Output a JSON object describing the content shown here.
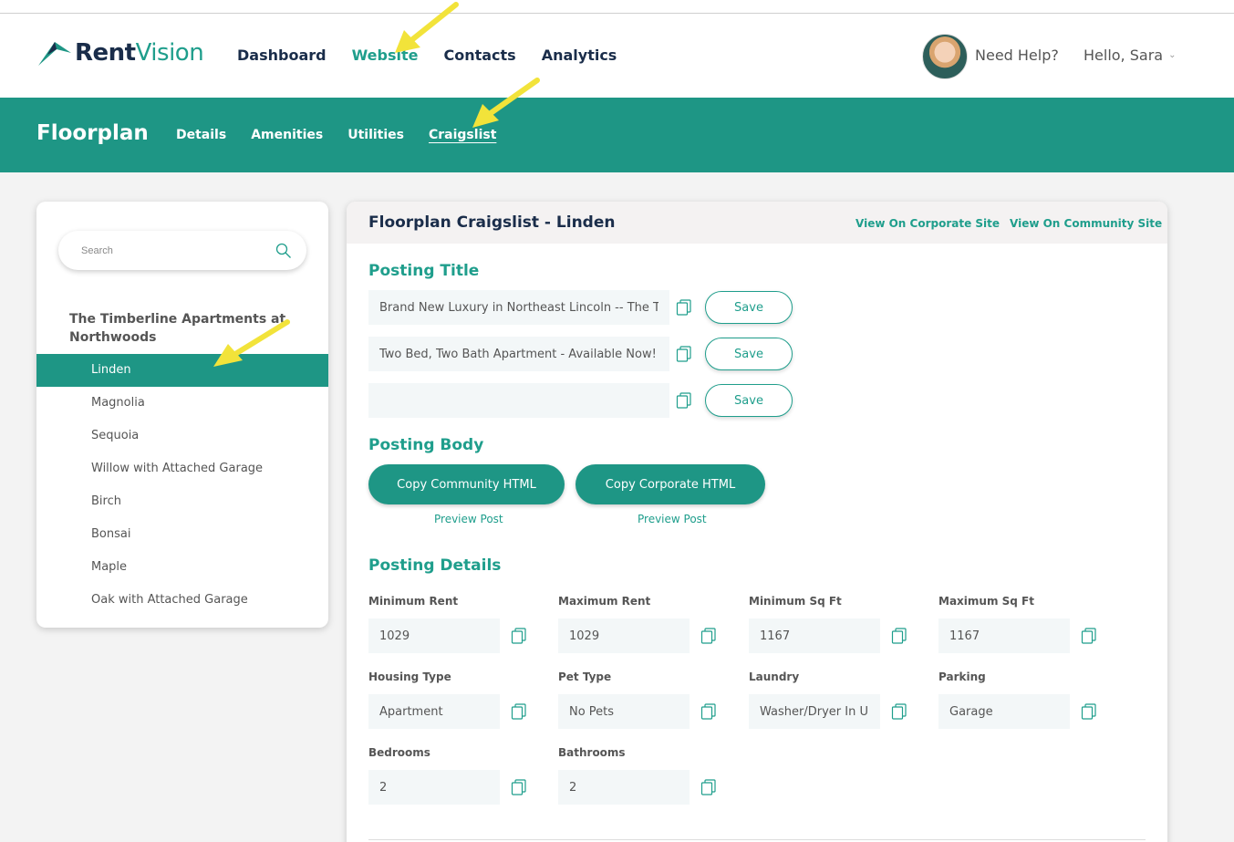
{
  "brand": {
    "name_part1": "Rent",
    "name_part2": "Vision",
    "accent": "#1e9685",
    "navy": "#1a2d4a"
  },
  "nav": {
    "items": [
      "Dashboard",
      "Website",
      "Contacts",
      "Analytics"
    ],
    "active": "Website",
    "help": "Need Help?",
    "greeting": "Hello, Sara"
  },
  "subheader": {
    "title": "Floorplan",
    "tabs": [
      "Details",
      "Amenities",
      "Utilities",
      "Craigslist"
    ],
    "active": "Craigslist"
  },
  "sidebar": {
    "search_placeholder": "Search",
    "group_title": "The Timberline Apartments at Northwoods",
    "items": [
      "Linden",
      "Magnolia",
      "Sequoia",
      "Willow with Attached Garage",
      "Birch",
      "Bonsai",
      "Maple",
      "Oak with Attached Garage"
    ],
    "active": "Linden"
  },
  "main": {
    "title": "Floorplan Craigslist - Linden",
    "link_corporate": "View On Corporate Site",
    "link_community": "View On Community Site",
    "posting_title": {
      "heading": "Posting Title",
      "titles": [
        "Brand New Luxury in Northeast Lincoln -- The Timberline",
        "Two Bed, Two Bath Apartment - Available Now!",
        ""
      ],
      "save_label": "Save"
    },
    "posting_body": {
      "heading": "Posting Body",
      "community_button": "Copy Community HTML",
      "corporate_button": "Copy Corporate HTML",
      "preview_label": "Preview Post"
    },
    "posting_details": {
      "heading": "Posting Details",
      "min_rent": {
        "label": "Minimum Rent",
        "value": "1029"
      },
      "max_rent": {
        "label": "Maximum Rent",
        "value": "1029"
      },
      "min_sqft": {
        "label": "Minimum Sq Ft",
        "value": "1167"
      },
      "max_sqft": {
        "label": "Maximum Sq Ft",
        "value": "1167"
      },
      "housing_type": {
        "label": "Housing Type",
        "value": "Apartment"
      },
      "pet_type": {
        "label": "Pet Type",
        "value": "No Pets"
      },
      "laundry": {
        "label": "Laundry",
        "value": "Washer/Dryer In Unit"
      },
      "parking": {
        "label": "Parking",
        "value": "Garage"
      },
      "bedrooms": {
        "label": "Bedrooms",
        "value": "2"
      },
      "bathrooms": {
        "label": "Bathrooms",
        "value": "2"
      }
    }
  },
  "icons": {
    "copy": "copy-icon",
    "search": "search-icon",
    "chevron": "chevron-down-icon",
    "annotation": "yellow-arrow-annotation"
  }
}
